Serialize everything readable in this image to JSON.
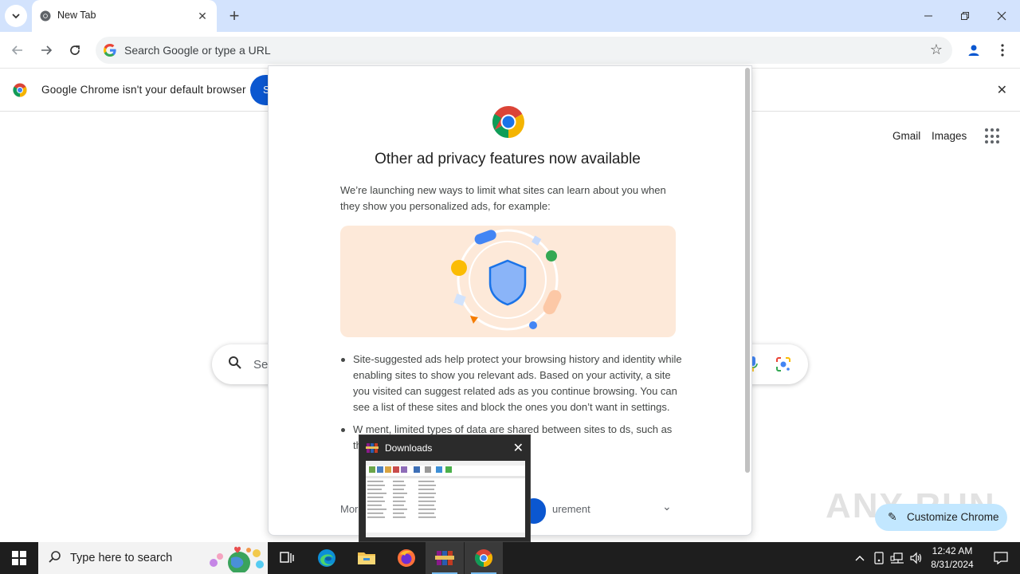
{
  "browser": {
    "tab": {
      "title": "New Tab"
    },
    "omnibox": {
      "placeholder": "Search Google or type a URL"
    }
  },
  "infobar": {
    "message": "Google Chrome isn't your default browser",
    "button_label": "S"
  },
  "ntp": {
    "links": {
      "gmail": "Gmail",
      "images": "Images"
    },
    "search_placeholder": "Se",
    "customize_label": "Customize Chrome"
  },
  "dialog": {
    "title": "Other ad privacy features now available",
    "intro": "We’re launching new ways to limit what sites can learn about you when they show you personalized ads, for example:",
    "bullets": [
      "Site-suggested ads help protect your browsing history and identity while enabling sites to show you relevant ads. Based on your activity, a site you visited can suggest related ads as you continue browsing. You can see a list of these sites and block the ones you don’t want in settings.",
      "W                  ment, limited types of data are shared between sites to                          ds, such as the time of day an ad"
    ],
    "footer": {
      "more": "More",
      "measurement": "urement"
    }
  },
  "watermark": "ANY RUN",
  "preview": {
    "title": "Downloads"
  },
  "taskbar": {
    "search_placeholder": "Type here to search",
    "time": "12:42 AM",
    "date": "8/31/2024"
  },
  "colors": {
    "titlebar": "#d3e3fd",
    "accent_blue": "#0b57d0",
    "illustration_bg": "#fde9d9",
    "customize_bg": "#c2e7ff"
  }
}
